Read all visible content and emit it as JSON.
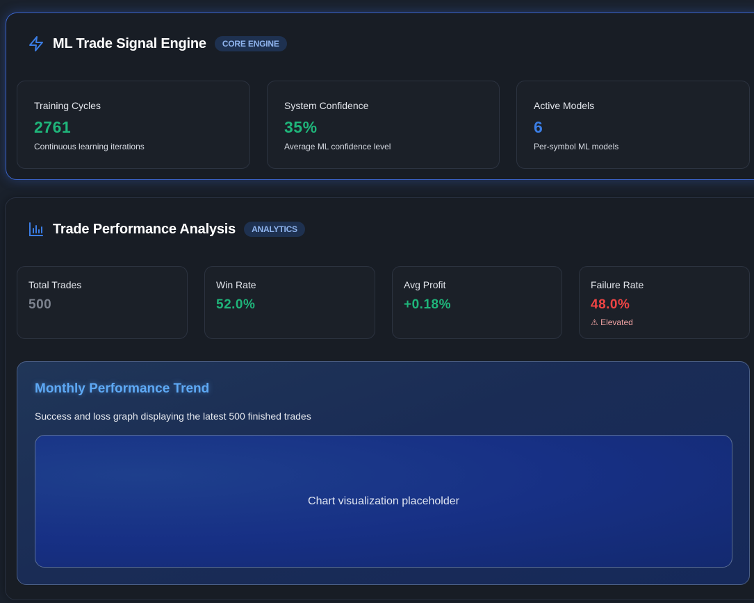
{
  "engine": {
    "title": "ML Trade Signal Engine",
    "badge": "CORE ENGINE",
    "icon": "lightning-icon",
    "cards": [
      {
        "label": "Training Cycles",
        "value": "2761",
        "sub": "Continuous learning iterations"
      },
      {
        "label": "System Confidence",
        "value": "35%",
        "sub": "Average ML confidence level"
      },
      {
        "label": "Active Models",
        "value": "6",
        "sub": "Per-symbol ML models"
      }
    ]
  },
  "analysis": {
    "title": "Trade Performance Analysis",
    "badge": "ANALYTICS",
    "icon": "bar-chart-icon",
    "cards": [
      {
        "label": "Total Trades",
        "value": "500"
      },
      {
        "label": "Win Rate",
        "value": "52.0%"
      },
      {
        "label": "Avg Profit",
        "value": "+0.18%"
      },
      {
        "label": "Failure Rate",
        "value": "48.0%",
        "sub": "⚠ Elevated"
      }
    ],
    "trend": {
      "title": "Monthly Performance Trend",
      "description": "Success and loss graph displaying the latest 500 finished trades",
      "placeholder": "Chart visualization placeholder"
    }
  },
  "colors": {
    "accent": "#3b7ee6",
    "positive": "#1fb57a",
    "negative": "#ef4444",
    "neutral": "#7d838f"
  }
}
